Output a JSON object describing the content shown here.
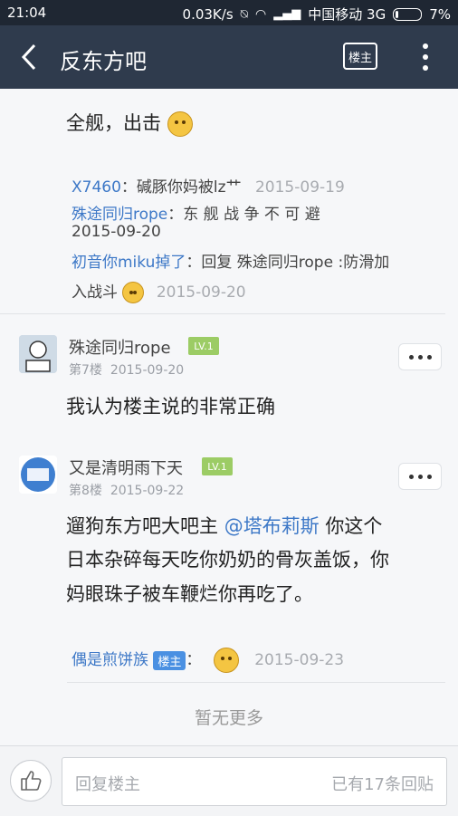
{
  "status": {
    "time": "21:04",
    "speed": "0.03K/s",
    "carrier": "中国移动 3G",
    "battery": "7%"
  },
  "nav": {
    "title": "反东方吧",
    "owner_btn": "楼主"
  },
  "top_post": {
    "text": "全舰，出击"
  },
  "sub_replies": [
    {
      "user": "X7460",
      "sep": "：",
      "text": "碱豚你妈被lz艹",
      "date": "2015-09-19"
    },
    {
      "user": "殊途同归rope",
      "sep": "：",
      "text": "东 舰 战 争 不 可 避",
      "date": "2015-09-20"
    },
    {
      "user": "初音你miku掉了",
      "sep": "：",
      "text1": "回复 殊途同归rope :防滑加",
      "text2": "入战斗",
      "date": "2015-09-20"
    }
  ],
  "posts": [
    {
      "user": "殊途同归rope",
      "level": "LV.1",
      "floor": "第7楼",
      "date": "2015-09-20",
      "text": "我认为楼主说的非常正确"
    },
    {
      "user": "又是清明雨下天",
      "level": "LV.1",
      "floor": "第8楼",
      "date": "2015-09-22",
      "text_a": "遛狗东方吧大吧主",
      "mention": "@塔布莉斯",
      "text_b": "你这个",
      "line2": "日本杂碎每天吃你奶奶的骨灰盖饭，你",
      "line3": "妈眼珠子被车鞭烂你再吃了。"
    }
  ],
  "last_sub": {
    "user": "偶是煎饼族",
    "tag": "楼主",
    "sep": "：",
    "date": "2015-09-23"
  },
  "no_more": "暂无更多",
  "bottom": {
    "placeholder": "回复楼主",
    "count": "已有17条回贴"
  },
  "colors": {
    "navbar": "#2f3b4d",
    "link": "#3d78c7",
    "level_badge": "#9ccc65",
    "owner_tag": "#4a90e2"
  }
}
